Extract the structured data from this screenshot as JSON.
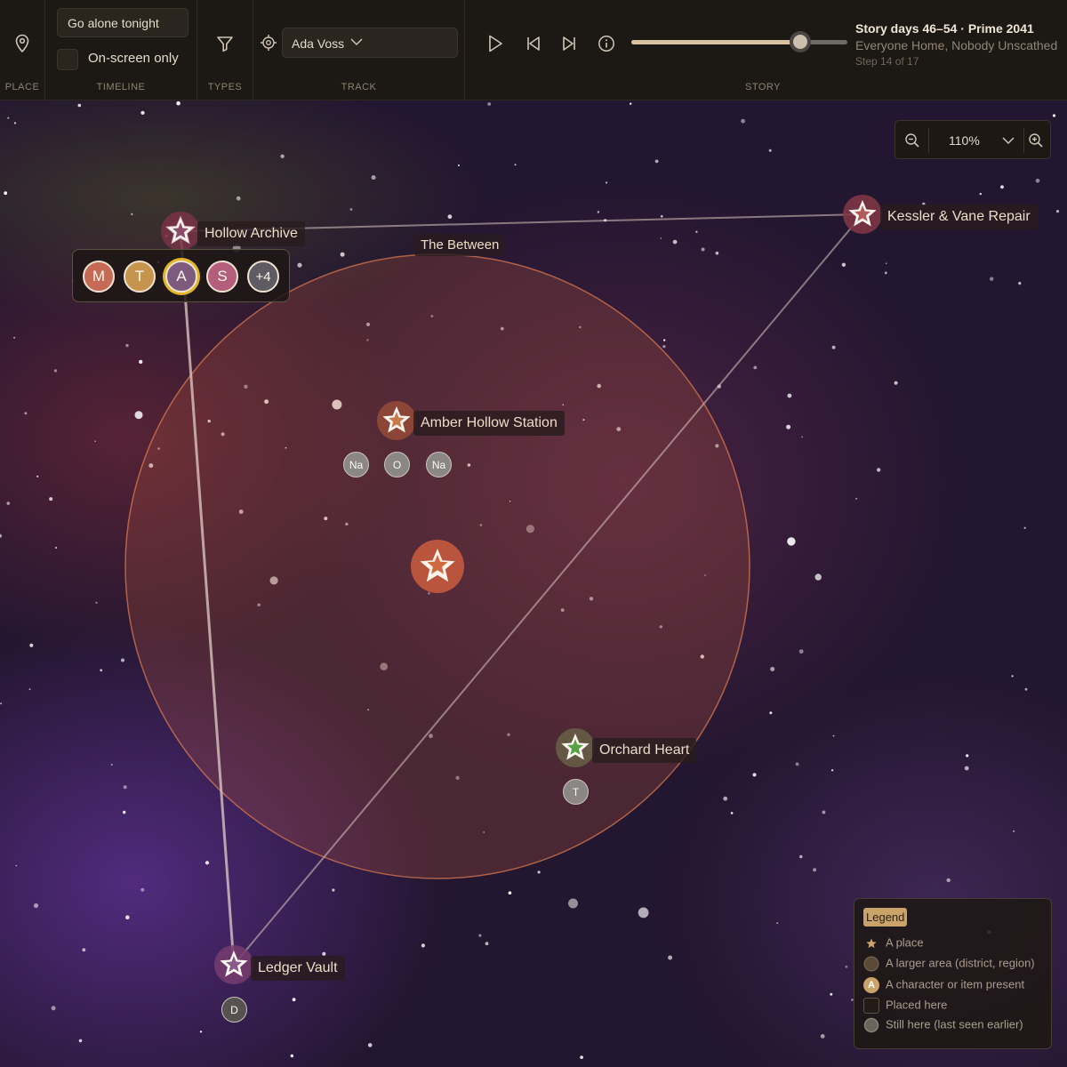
{
  "toolbar": {
    "place": {
      "label": "PLACE",
      "icon": "location-pin-icon"
    },
    "timeline": {
      "label": "TIMELINE",
      "input_value": "Go alone tonight",
      "checkbox_label": "On-screen only",
      "checkbox_checked": false
    },
    "types": {
      "label": "TYPES",
      "icon": "filter-icon"
    },
    "track": {
      "label": "TRACK",
      "icon": "target-icon",
      "selected": "Ada Voss"
    },
    "story": {
      "label": "STORY",
      "title": "Story days 46–54 · Prime 2041",
      "subtitle": "Everyone Home, Nobody Unscathed",
      "step": "Step 14 of 17",
      "progress": 0.78
    }
  },
  "zoom": {
    "value": "110%"
  },
  "map": {
    "region": {
      "name": "The Between"
    },
    "places": [
      {
        "id": "hollow-archive",
        "name": "Hollow Archive"
      },
      {
        "id": "kessler-vane",
        "name": "Kessler & Vane Repair"
      },
      {
        "id": "amber-hollow",
        "name": "Amber Hollow Station"
      },
      {
        "id": "orchard-heart",
        "name": "Orchard Heart"
      },
      {
        "id": "ledger-vault",
        "name": "Ledger Vault"
      }
    ],
    "characters_hollow_archive": [
      {
        "initial": "M",
        "color": "#c56a54"
      },
      {
        "initial": "T",
        "color": "#c7944e"
      },
      {
        "initial": "A",
        "color": "#7e5a7c",
        "selected": true
      },
      {
        "initial": "S",
        "color": "#b35f7b"
      },
      {
        "initial": "+4",
        "color": "#5f5b63"
      }
    ],
    "amber_badges": [
      "Na",
      "O",
      "Na"
    ],
    "orchard_badges": [
      "T"
    ],
    "ledger_badges": [
      "D"
    ]
  },
  "legend": {
    "title": "Legend",
    "items": [
      "A place",
      "A larger area (district, region)",
      "A character or item present",
      "Placed here",
      "Still here (last seen earlier)"
    ],
    "char_symbol": "A"
  }
}
